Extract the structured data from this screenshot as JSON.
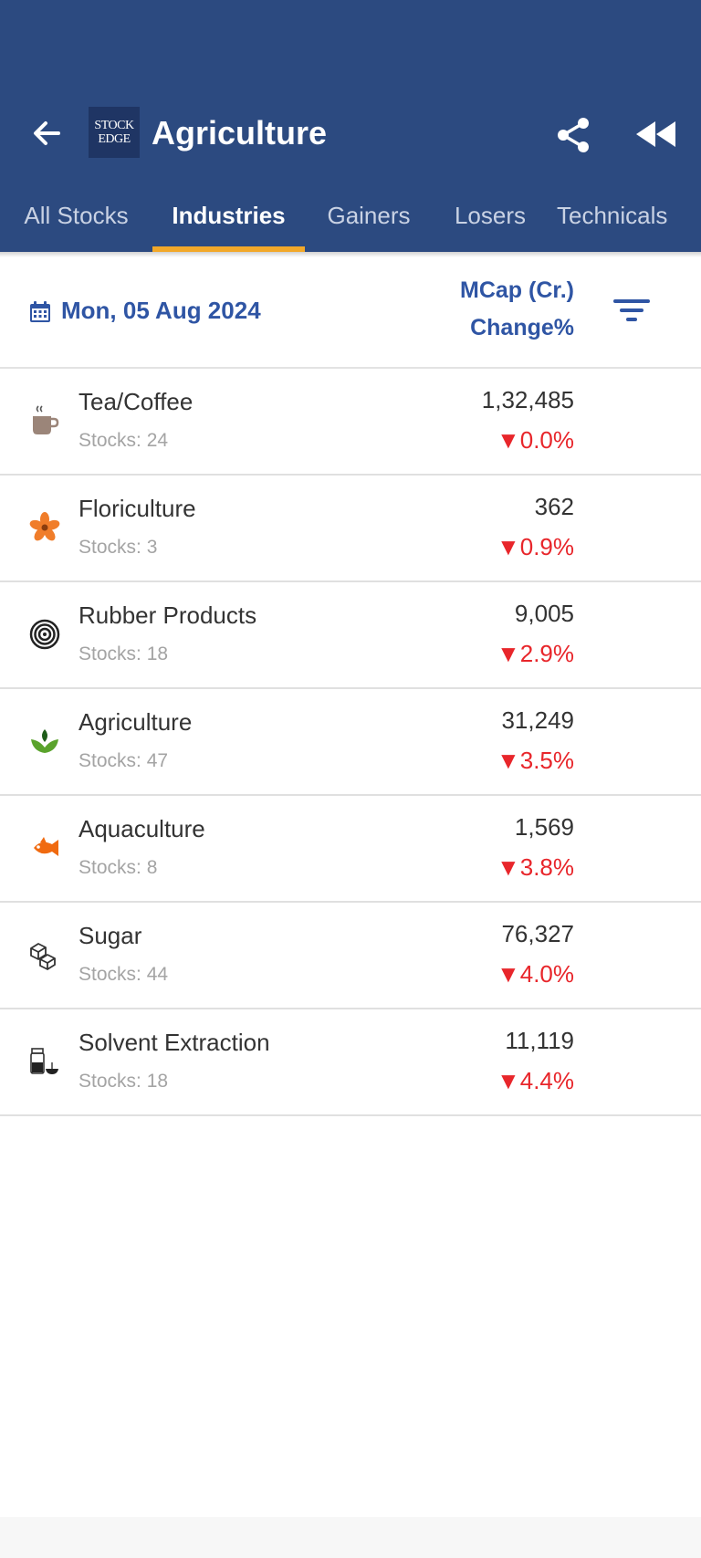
{
  "header": {
    "title": "Agriculture",
    "logo_line1": "STOCK",
    "logo_line2": "EDGE",
    "back_icon": "arrow-left-icon",
    "share_icon": "share-icon",
    "rewind_icon": "rewind-icon"
  },
  "tabs": [
    {
      "label": "All Stocks",
      "active": false
    },
    {
      "label": "Industries",
      "active": true
    },
    {
      "label": "Gainers",
      "active": false
    },
    {
      "label": "Losers",
      "active": false
    },
    {
      "label": "Technicals",
      "active": false
    }
  ],
  "filterbar": {
    "date": "Mon, 05 Aug 2024",
    "col_mcap": "MCap (Cr.)",
    "col_change": "Change%",
    "calendar_icon": "calendar-icon",
    "filter_icon": "filter-icon"
  },
  "industries": [
    {
      "name": "Tea/Coffee",
      "stocks": "Stocks: 24",
      "mcap": "1,32,485",
      "change": "▼0.0%",
      "icon": "coffee-cup-icon"
    },
    {
      "name": "Floriculture",
      "stocks": "Stocks: 3",
      "mcap": "362",
      "change": "▼0.9%",
      "icon": "flower-icon"
    },
    {
      "name": "Rubber Products",
      "stocks": "Stocks: 18",
      "mcap": "9,005",
      "change": "▼2.9%",
      "icon": "rubber-coil-icon"
    },
    {
      "name": "Agriculture",
      "stocks": "Stocks: 47",
      "mcap": "31,249",
      "change": "▼3.5%",
      "icon": "plant-icon"
    },
    {
      "name": "Aquaculture",
      "stocks": "Stocks: 8",
      "mcap": "1,569",
      "change": "▼3.8%",
      "icon": "fish-icon"
    },
    {
      "name": "Sugar",
      "stocks": "Stocks: 44",
      "mcap": "76,327",
      "change": "▼4.0%",
      "icon": "sugar-cubes-icon"
    },
    {
      "name": "Solvent Extraction",
      "stocks": "Stocks: 18",
      "mcap": "11,119",
      "change": "▼4.4%",
      "icon": "solvent-jar-icon"
    }
  ],
  "colors": {
    "appbar": "#2c4a80",
    "accent": "#2f55a4",
    "tab_indicator": "#f2a829",
    "negative": "#e8262b"
  }
}
